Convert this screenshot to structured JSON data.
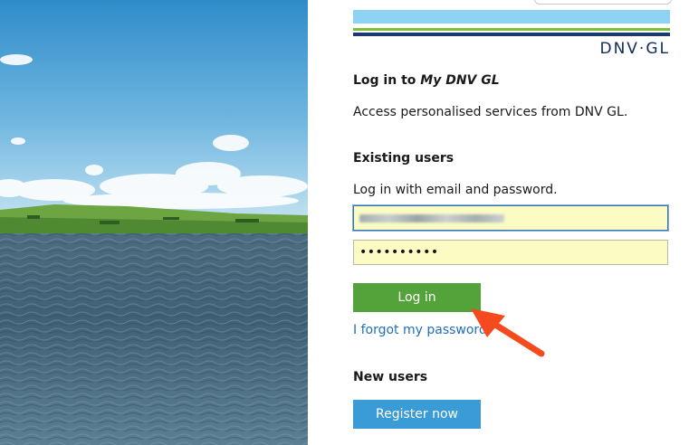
{
  "brand": {
    "logo_text": "DNV·GL"
  },
  "login": {
    "title_prefix": "Log in to ",
    "title_brand": "My DNV GL",
    "subtitle": "Access personalised services from DNV GL."
  },
  "existing_users": {
    "heading": "Existing users",
    "hint": "Log in with email and password.",
    "password_mask": "••••••••••",
    "login_button": "Log in",
    "forgot_link": "I forgot my password"
  },
  "new_users": {
    "heading": "New users",
    "register_button": "Register now"
  },
  "colors": {
    "brand_navy": "#0f2b5c",
    "login_green": "#53a23a",
    "register_blue": "#3b9bd6",
    "annotation_arrow": "#f44a1e"
  }
}
